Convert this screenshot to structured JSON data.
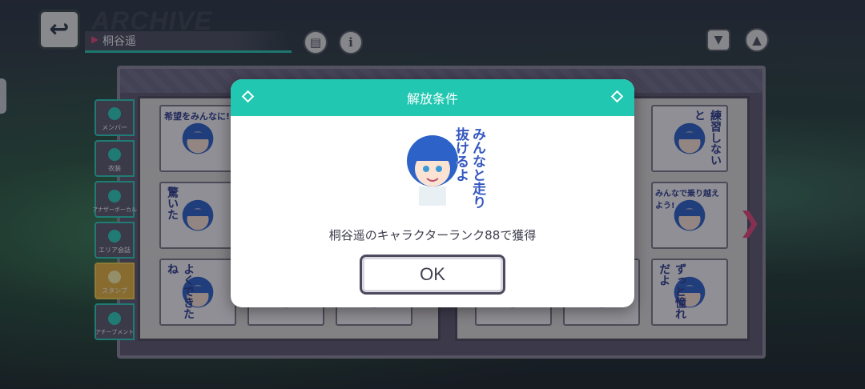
{
  "header": {
    "title": "ARCHIVE",
    "character_name": "桐谷遥"
  },
  "side_tabs": [
    {
      "label": "メンバー",
      "icon": "member-icon",
      "active": false
    },
    {
      "label": "衣装",
      "icon": "costume-icon",
      "active": false
    },
    {
      "label": "アナザーボーカル",
      "icon": "another-vocal-icon",
      "active": false
    },
    {
      "label": "エリア会話",
      "icon": "area-talk-icon",
      "active": false
    },
    {
      "label": "スタンプ",
      "icon": "stamp-icon",
      "active": true
    },
    {
      "label": "アチーブメント",
      "icon": "achievement-icon",
      "active": false
    }
  ],
  "stickers": {
    "left_page": [
      {
        "text": "希望をみんなに!"
      },
      {
        "text": "驚いた"
      },
      {
        "text": "よくできたね"
      }
    ],
    "right_page": [
      {
        "text": "練習しないと"
      },
      {
        "text": "みんなで乗り越えよう!"
      },
      {
        "text": "ずっと憧れだよ"
      }
    ]
  },
  "modal": {
    "title": "解放条件",
    "stamp_text": "みんなと走り抜けるよ",
    "condition": "桐谷遥のキャラクターランク88で獲得",
    "ok_label": "OK"
  },
  "colors": {
    "accent_teal": "#22c7b1",
    "accent_pink": "#e2467a",
    "stamp_tab_gold": "#e7b23c",
    "hair_blue": "#2d62c8"
  }
}
